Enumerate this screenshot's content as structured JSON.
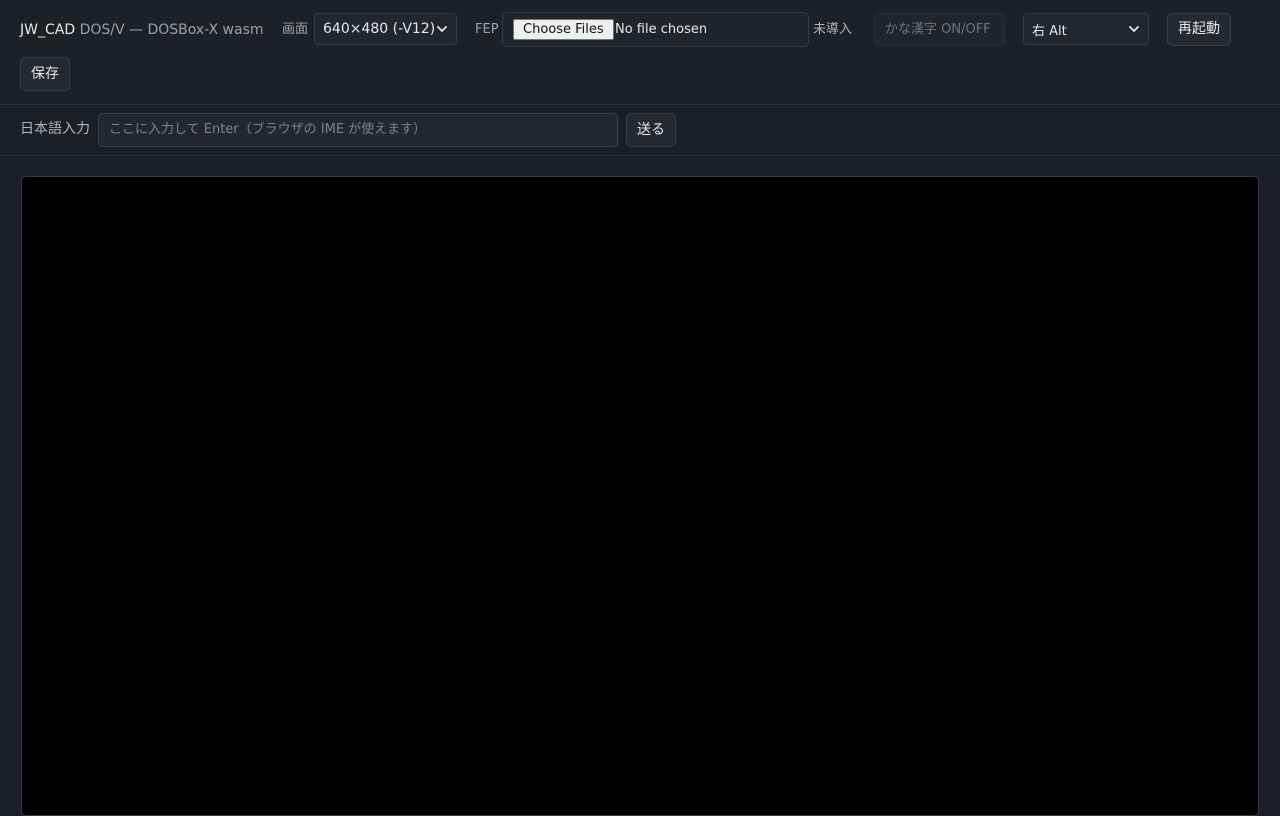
{
  "header": {
    "title_main": "JW_CAD",
    "title_sub": "DOS/V — DOSBox-X wasm"
  },
  "screen_control": {
    "label": "画面",
    "selected": "640×480 (-V12)"
  },
  "fep": {
    "label": "FEP",
    "file_button": "Choose Files",
    "file_status": "No file chosen",
    "status": "未導入"
  },
  "kana_kanji": {
    "placeholder": "かな漢字 ON/OFF"
  },
  "key_select": {
    "selected": "右 Alt"
  },
  "buttons": {
    "restart": "再起動",
    "save": "保存",
    "send": "送る"
  },
  "ime_input": {
    "label": "日本語入力",
    "placeholder": "ここに入力して Enter（ブラウザの IME が使えます）"
  },
  "colors": {
    "background": "#1b1e24",
    "screen": "#000000",
    "text": "#e6e8ec"
  }
}
